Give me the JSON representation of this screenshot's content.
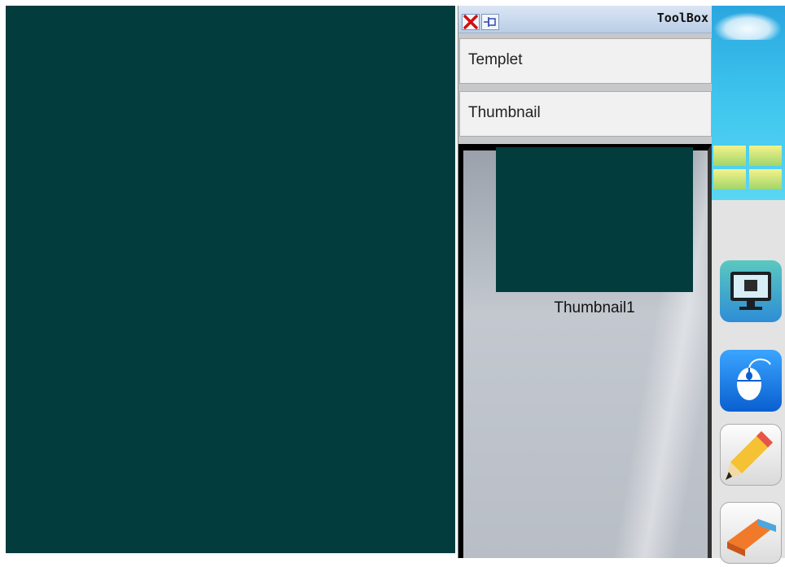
{
  "toolbox": {
    "title": "ToolBox",
    "close_icon": "close-icon",
    "pin_icon": "pin-icon",
    "sections": {
      "templet": "Templet",
      "thumbnail": "Thumbnail"
    },
    "thumbnails": [
      {
        "label": "Thumbnail1",
        "color": "#023c3d"
      }
    ]
  },
  "board": {
    "background_color": "#023c3d"
  },
  "dock": {
    "icons": [
      "windows-logo-icon",
      "desktop-icon",
      "mouse-icon",
      "pencil-icon",
      "eraser-icon"
    ]
  }
}
